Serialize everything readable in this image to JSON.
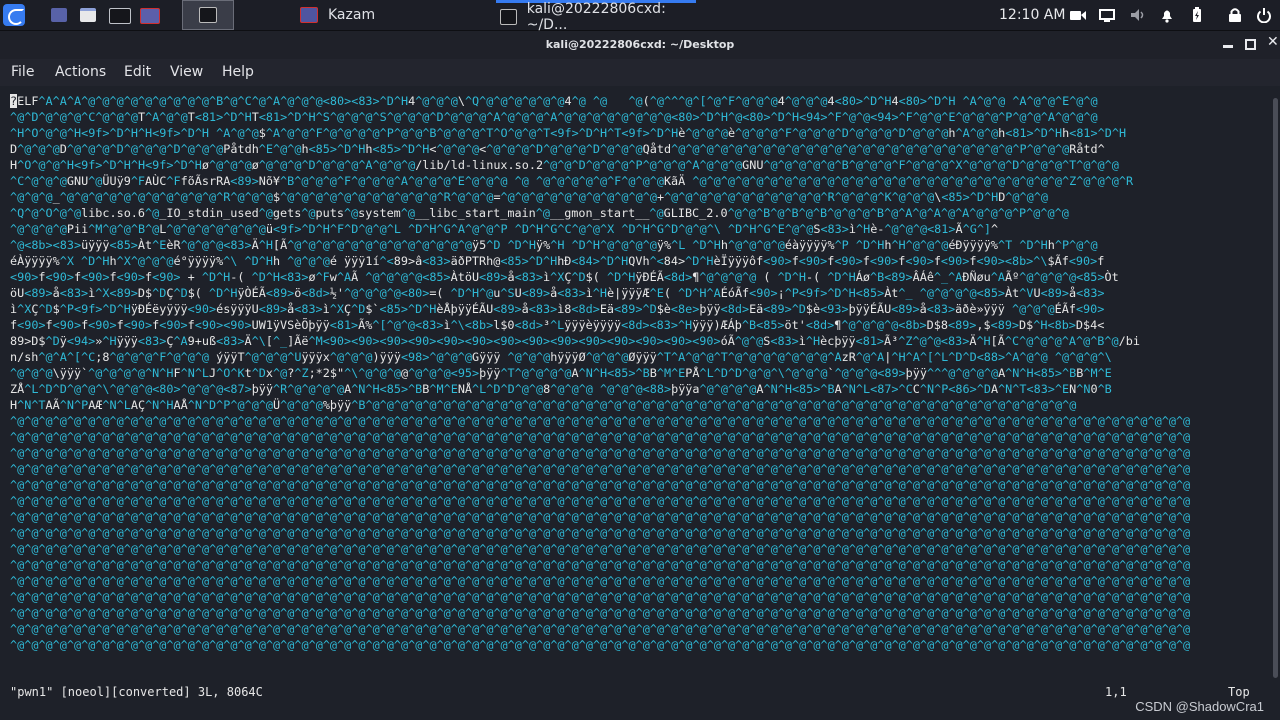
{
  "colors": {
    "accent": "#367bf0",
    "ctrl_chars": "#2fb9d6",
    "text": "#e6e6e6"
  },
  "panel": {
    "launcher_icons": [
      "kali-menu-icon",
      "show-desktop-icon",
      "file-manager-icon",
      "terminal-launcher-icon",
      "kazam-launcher-icon"
    ],
    "windows": [
      {
        "label": "",
        "icon": "terminal-icon",
        "active": false
      },
      {
        "label": "Kazam",
        "icon": "kazam-icon",
        "active": false
      },
      {
        "label": "kali@20222806cxd: ~/D...",
        "icon": "terminal-icon",
        "active": true
      }
    ],
    "clock": "12:10 AM",
    "tray_icons": [
      "camera-icon",
      "screen-icon",
      "volume-icon",
      "bell-icon",
      "battery-icon",
      "lock-icon",
      "power-icon"
    ]
  },
  "window": {
    "title": "kali@20222806cxd: ~/Desktop",
    "menu": [
      "File",
      "Actions",
      "Edit",
      "View",
      "Help"
    ]
  },
  "terminal": {
    "lines": [
      "?ELF^A^A^A^@^@^@^@^@^@^@^@^@^B^@^C^@^A^@^@^@<80><83>^D^H4^@^@^@\\^Q^@^@^@^@^@^@4^@ ^@   ^@(^@^^^@^[^@^F^@^@^@4^@^@^@4<80>^D^H4<80>^D^H ^A^@^@ ^A^@^@^E^@^@",
      "^@^D^@^@^@^C^@^@^@T^A^@^@T<81>^D^HT<81>^D^H^S^@^@^@^S^@^@^@^D^@^@^@^A^@^@^@^A^@^@^@^@^@^@^@^@<80>^D^H^@<80>^D^H<94>^F^@^@<94>^F^@^@^E^@^@^@^P^@^@^A^@^@^@",
      "^H^O^@^@^H<9f>^D^H^H<9f>^D^H ^A^@^@$^A^@^@^F^@^@^@^@^P^@^@^B^@^@^@^T^O^@^@^T<9f>^D^H^T<9f>^D^Hè^@^@^@è^@^@^@^F^@^@^@^D^@^@^@^D^@^@^@h^A^@^@h<81>^D^Hh<81>^D^H",
      "D^@^@^@D^@^@^@^D^@^@^@^D^@^@^@Påtdh^E^@^@h<85>^D^Hh<85>^D^H<^@^@^@<^@^@^@^D^@^@^@^D^@^@^@Qåtd^@^@^@^@^@^@^@^@^@^@^@^@^@^@^@^@^@^@^@^@^@^@^@^@^P^@^@^@Råtd^",
      "H^O^@^@^H<9f>^D^H^H<9f>^D^Hø^@^@^@ø^@^@^@^D^@^@^@^A^@^@^@/lib/ld-linux.so.2^@^@^D^@^@^@^P^@^@^@^A^@^@^@GNU^@^@^@^@^@^B^@^@^@^F^@^@^@^X^@^@^@^D^@^@^@^T^@^@^@",
      "^C^@^@^@GNU^@ÜUÿ9^FAÙC^FfõÃsrRA<89>Nõ¥^B^@^@^@^F^@^@^@^A^@^@^@^E^@^@^@ ^@ ^@^@^@^@^@^F^@^@^@KãÄ ^@^@^@^@^@^@^@^@^@^@^@^@^@^@^@^@^@^@^@^@^@^@^@^@^@^@^Z^@^@^@^R",
      "^@^@^@_^@^@^@^@^@^@^@^@^@^@^@^R^@^@^@$^@^@^@^@^@^@^@^@^@^@^@^R^@^@^@=^@^@^@^@^@^@^@^@^@^@^@+^@^@^@^@^@^@^@^@^@^@^@^R^@^@^@^K^@^@^@\\<85>^D^HD^@^@^@",
      "^Q^@^O^@^@libc.so.6^@_IO_stdin_used^@gets^@puts^@system^@__libc_start_main^@__gmon_start__^@GLIBC_2.0^@^@^B^@^B^@^B^@^@^@^B^@^A^@^A^@^A^@^@^@^P^@^@^@",
      "^@^@^@^@Pii^M^@^@^B^@L^@^@^@^@^@^@^@ü<9f>^D^H^F^D^@^@^L ^D^H^G^A^@^@^P ^D^H^G^C^@^@^X ^D^H^G^D^@^@^\\ ^D^H^G^E^@^@S<83>ì^Hè-^@^@^@<81>Ã^G^]^",
      "^@<8b><83>üÿÿÿ<85>Àt^EèR^@^@^@<83>Ä^H[Ã^@^@^@^@^@^@^@^@^@^@^@^@^@ÿ5^D ^D^Hÿ%^H ^D^H^@^@^@^@ÿ%^L ^D^Hh^@^@^@^@éàÿÿÿÿ%^P ^D^Hh^H^@^@^@éÐÿÿÿÿ%^T ^D^Hh^P^@^@",
      "éÀÿÿÿÿ%^X ^D^Hh^X^@^@^@é°ÿÿÿÿ%^\\ ^D^Hh ^@^@^@é ÿÿÿ1í^<89>â<83>äðPTRh@<85>^D^HhÐ<84>^D^HQVh^<84>^D^HèÏÿÿÿôf<90>f<90>f<90>f<90>f<90>f<90>f<90><8b>^\\$Ãf<90>f",
      "<90>f<90>f<90>f<90>f<90> + ^D^H-( ^D^H<83>ø^Fw^AÃ ^@^@^@^@<85>ÀtöU<89>å<83>ì^XÇ^D$( ^D^HÿÐÉÃ<8d>¶^@^@^@^@ ( ^D^H-( ^D^HÁø^B<89>ÂÁê^_^AÐÑøu^AÃº^@^@^@^@<85>Òt",
      "öU<89>å<83>ì^X<89>D$^DÇ^D$( ^D^HÿÒÉÃ<89>ö<8d>½'^@^@^@^@<80>=( ^D^H^@u^SU<89>å<83>ì^Hè|ÿÿÿÆ^E( ^D^H^AÉóÃf<90>¡^P<9f>^D^H<85>Àt^_ ^@^@^@^@<85>Àt^VU<89>å<83>",
      "ì^XÇ^D$^P<9f>^D^HÿÐÉëyÿÿÿ<90>ésÿÿÿU<89>å<83>ì^XÇ^D$`<85>^D^HèÅþÿÿÉÃU<89>å<83>ì8<8d>Eä<89>^D$è<8e>þÿÿ<8d>Eä<89>^D$è<93>þÿÿÉÃU<89>å<83>äðè»ÿÿÿ ^@^@^@ÉÃf<90>",
      "f<90>f<90>f<90>f<90>f<90>f<90><90>UW1ÿVSèÕþÿÿ<81>Ã%^[^@^@<83>ì^\\<8b>l$0<8d>³^Lÿÿÿèÿÿÿÿ<8d><83>^Hÿÿÿ)ÆÁþ^B<85>öt'<8d>¶^@^@^@^@<8b>D$8<89>,$<89>D$^H<8b>D$4<",
      "89>D$^Dÿ<94>»^Hÿÿÿ<83>Ç^A9+uß<83>Ä^\\[^_]Ãë^M<90><90><90><90><90><90><90><90><90><90><90><90><90><90>óÃ^@^@S<83>ì^Hècþÿÿ<81>Ã³^Z^@^@<83>Ä^H[Ã^C^@^@^@^A^@^B^@/bi",
      "n/sh^@^A^[^C;8^@^@^@^F^@^@^@ ýÿÿT^@^@^@^Uÿÿÿx^@^@^@)ÿÿÿ<98>^@^@^@Gÿÿÿ ^@^@^@hÿÿÿØ^@^@^@Øÿÿÿ^T^A^@^@^T^@^@^@^@^@^@^@^AzR^@^A|^H^A^[^L^D^D<88>^A^@^@ ^@^@^@^\\",
      "^@^@^@\\ÿÿÿ`^@^@^@^@^N^HF^N^LJ^O^Kt^Dx^@?^Z;*2$\"^\\^@^@^@@^@^@^@<95>þÿÿ^T^@^@^@^@A^N^H<85>^BB^M^EPÅ^L^D^D^@^@^\\^@^@^@`^@^@^@<89>þÿÿ^^^@^@^@^@A^N^H<85>^BB^M^E",
      "ZÅ^L^D^D^@^@^\\^@^@^@<80>^@^@^@<87>þÿÿ^R^@^@^@^@A^N^H<85>^BB^M^ENÅ^L^D^D^@^@8^@^@^@ ^@^@^@<88>þÿÿa^@^@^@^@A^N^H<85>^BA^N^L<87>^CC^N^P<86>^DA^N^T<83>^EN^N0^B",
      "H^N^TAÃ^N^PAÆ^N^LAÇ^N^HAÅ^N^D^P^@^@^@Ü^@^@^@%þÿÿ^B^@^@^@^@^@^@^@^@^@^@^@^@^@^@^@^@^@^@^@^@^@^@^@^@^@^@^@^@^@^@^@^@^@^@^@^@^@^@^@^@^@^@^@^@^@^@^@^@^@^@",
      "^@^@^@^@^@^@^@^@^@^@^@^@^@^@^@^@^@^@^@^@^@^@^@^@^@^@^@^@^@^@^@^@^@^@^@^@^@^@^@^@^@^@^@^@^@^@^@^@^@^@^@^@^@^@^@^@^@^@^@^@^@^@^@^@^@^@^@^@^@^@^@^@^@^@^@^@^@^@^@^@^@^@^@",
      "^@^@^@^@^@^@^@^@^@^@^@^@^@^@^@^@^@^@^@^@^@^@^@^@^@^@^@^@^@^@^@^@^@^@^@^@^@^@^@^@^@^@^@^@^@^@^@^@^@^@^@^@^@^@^@^@^@^@^@^@^@^@^@^@^@^@^@^@^@^@^@^@^@^@^@^@^@^@^@^@^@^@^@",
      "^@^@^@^@^@^@^@^@^@^@^@^@^@^@^@^@^@^@^@^@^@^@^@^@^@^@^@^@^@^@^@^@^@^@^@^@^@^@^@^@^@^@^@^@^@^@^@^@^@^@^@^@^@^@^@^@^@^@^@^@^@^@^@^@^@^@^@^@^@^@^@^@^@^@^@^@^@^@^@^@^@^@^@",
      "^@^@^@^@^@^@^@^@^@^@^@^@^@^@^@^@^@^@^@^@^@^@^@^@^@^@^@^@^@^@^@^@^@^@^@^@^@^@^@^@^@^@^@^@^@^@^@^@^@^@^@^@^@^@^@^@^@^@^@^@^@^@^@^@^@^@^@^@^@^@^@^@^@^@^@^@^@^@^@^@^@^@^@",
      "^@^@^@^@^@^@^@^@^@^@^@^@^@^@^@^@^@^@^@^@^@^@^@^@^@^@^@^@^@^@^@^@^@^@^@^@^@^@^@^@^@^@^@^@^@^@^@^@^@^@^@^@^@^@^@^@^@^@^@^@^@^@^@^@^@^@^@^@^@^@^@^@^@^@^@^@^@^@^@^@^@^@^@",
      "^@^@^@^@^@^@^@^@^@^@^@^@^@^@^@^@^@^@^@^@^@^@^@^@^@^@^@^@^@^@^@^@^@^@^@^@^@^@^@^@^@^@^@^@^@^@^@^@^@^@^@^@^@^@^@^@^@^@^@^@^@^@^@^@^@^@^@^@^@^@^@^@^@^@^@^@^@^@^@^@^@^@^@",
      "^@^@^@^@^@^@^@^@^@^@^@^@^@^@^@^@^@^@^@^@^@^@^@^@^@^@^@^@^@^@^@^@^@^@^@^@^@^@^@^@^@^@^@^@^@^@^@^@^@^@^@^@^@^@^@^@^@^@^@^@^@^@^@^@^@^@^@^@^@^@^@^@^@^@^@^@^@^@^@^@^@^@^@",
      "^@^@^@^@^@^@^@^@^@^@^@^@^@^@^@^@^@^@^@^@^@^@^@^@^@^@^@^@^@^@^@^@^@^@^@^@^@^@^@^@^@^@^@^@^@^@^@^@^@^@^@^@^@^@^@^@^@^@^@^@^@^@^@^@^@^@^@^@^@^@^@^@^@^@^@^@^@^@^@^@^@^@^@",
      "^@^@^@^@^@^@^@^@^@^@^@^@^@^@^@^@^@^@^@^@^@^@^@^@^@^@^@^@^@^@^@^@^@^@^@^@^@^@^@^@^@^@^@^@^@^@^@^@^@^@^@^@^@^@^@^@^@^@^@^@^@^@^@^@^@^@^@^@^@^@^@^@^@^@^@^@^@^@^@^@^@^@^@",
      "^@^@^@^@^@^@^@^@^@^@^@^@^@^@^@^@^@^@^@^@^@^@^@^@^@^@^@^@^@^@^@^@^@^@^@^@^@^@^@^@^@^@^@^@^@^@^@^@^@^@^@^@^@^@^@^@^@^@^@^@^@^@^@^@^@^@^@^@^@^@^@^@^@^@^@^@^@^@^@^@^@^@^@",
      "^@^@^@^@^@^@^@^@^@^@^@^@^@^@^@^@^@^@^@^@^@^@^@^@^@^@^@^@^@^@^@^@^@^@^@^@^@^@^@^@^@^@^@^@^@^@^@^@^@^@^@^@^@^@^@^@^@^@^@^@^@^@^@^@^@^@^@^@^@^@^@^@^@^@^@^@^@^@^@^@^@^@^@",
      "^@^@^@^@^@^@^@^@^@^@^@^@^@^@^@^@^@^@^@^@^@^@^@^@^@^@^@^@^@^@^@^@^@^@^@^@^@^@^@^@^@^@^@^@^@^@^@^@^@^@^@^@^@^@^@^@^@^@^@^@^@^@^@^@^@^@^@^@^@^@^@^@^@^@^@^@^@^@^@^@^@^@^@",
      "^@^@^@^@^@^@^@^@^@^@^@^@^@^@^@^@^@^@^@^@^@^@^@^@^@^@^@^@^@^@^@^@^@^@^@^@^@^@^@^@^@^@^@^@^@^@^@^@^@^@^@^@^@^@^@^@^@^@^@^@^@^@^@^@^@^@^@^@^@^@^@^@^@^@^@^@^@^@^@^@^@^@^@",
      "^@^@^@^@^@^@^@^@^@^@^@^@^@^@^@^@^@^@^@^@^@^@^@^@^@^@^@^@^@^@^@^@^@^@^@^@^@^@^@^@^@^@^@^@^@^@^@^@^@^@^@^@^@^@^@^@^@^@^@^@^@^@^@^@^@^@^@^@^@^@^@^@^@^@^@^@^@^@^@^@^@^@^@",
      "^@^@^@^@^@^@^@^@^@^@^@^@^@^@^@^@^@^@^@^@^@^@^@^@^@^@^@^@^@^@^@^@^@^@^@^@^@^@^@^@^@^@^@^@^@^@^@^@^@^@^@^@^@^@^@^@^@^@^@^@^@^@^@^@^@^@^@^@^@^@^@^@^@^@^@^@^@^@^@^@^@^@^@"
    ],
    "status_file": "\"pwn1\" [noeol][converted] 3L, 8064C",
    "status_pos": "1,1",
    "status_scroll": "Top"
  },
  "watermark": "CSDN @ShadowCra1"
}
